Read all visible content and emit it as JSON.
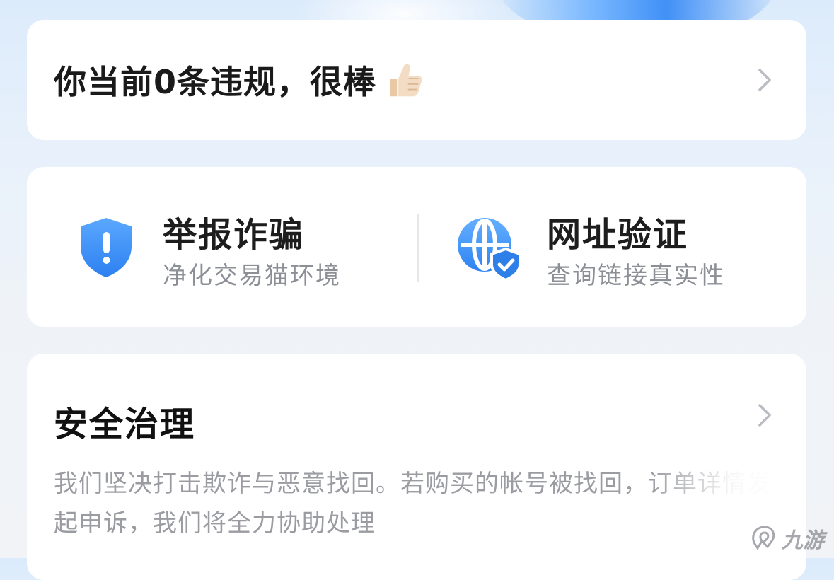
{
  "violation_card": {
    "text": "你当前0条违规，很棒",
    "emoji_icon": "thumbs-up-icon",
    "arrow_icon": "chevron-right-icon"
  },
  "tools": [
    {
      "title": "举报诈骗",
      "subtitle": "净化交易猫环境",
      "icon": "shield-exclamation-icon",
      "color": "#3a8ff5"
    },
    {
      "title": "网址验证",
      "subtitle": "查询链接真实性",
      "icon": "globe-shield-check-icon",
      "color": "#3a8ff5"
    }
  ],
  "governance": {
    "title": "安全治理",
    "description": "我们坚决打击欺诈与恶意找回。若购买的帐号被找回，订单详情发起申诉，我们将全力协助处理",
    "arrow_icon": "chevron-right-icon"
  },
  "watermark": {
    "text": "九游",
    "icon": "jiuyou-logo-icon"
  }
}
